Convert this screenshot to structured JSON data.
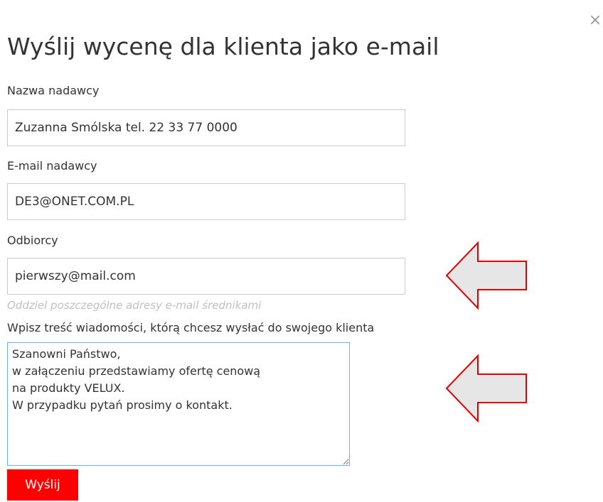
{
  "dialog": {
    "close_symbol": "×",
    "title": "Wyślij wycenę dla klienta jako e-mail",
    "sender_name": {
      "label": "Nazwa nadawcy",
      "value": "Zuzanna Smólska tel. 22 33 77 0000"
    },
    "sender_email": {
      "label": "E-mail nadawcy",
      "value": "DE3@ONET.COM.PL"
    },
    "recipients": {
      "label": "Odbiorcy",
      "value": "pierwszy@mail.com",
      "hint": "Oddziel poszczególne adresy e-mail średnikami"
    },
    "message": {
      "label": "Wpisz treść wiadomości, którą chcesz wysłać do swojego klienta",
      "value": "Szanowni Państwo,\nw załączeniu przedstawiamy ofertę cenową\nna produkty VELUX.\nW przypadku pytań prosimy o kontakt."
    },
    "send_label": "Wyślij"
  },
  "colors": {
    "accent_red": "#ff0000",
    "arrow_fill": "#e6e6e6",
    "arrow_stroke": "#e00000",
    "focus_border": "#66afe9"
  },
  "icons": {
    "close": "close-icon",
    "annotation": "left-arrow-icon"
  }
}
